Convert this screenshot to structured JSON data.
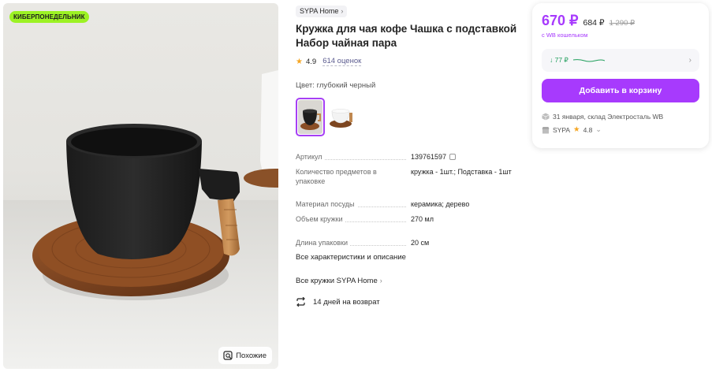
{
  "photo": {
    "badge": "КИБЕРПОНЕДЕЛЬНИК",
    "similar_button": "Похожие"
  },
  "product": {
    "brand": "SYPA Home",
    "title": "Кружка для чая кофе Чашка с подставкой Набор чайная пара",
    "rating": "4.9",
    "reviews": "614 оценок",
    "color_label": "Цвет: глубокий черный"
  },
  "specs": [
    {
      "key": "Артикул",
      "value": "139761597"
    },
    {
      "key": "Количество предметов в упаковке",
      "value": "кружка - 1шт.; Подставка - 1шт"
    },
    {
      "key": "Материал посуды",
      "value": "керамика; дерево"
    },
    {
      "key": "Объем кружки",
      "value": "270 мл"
    },
    {
      "key": "Длина упаковки",
      "value": "20 см"
    }
  ],
  "links": {
    "all_specs": "Все характеристики и описание",
    "all_brand": "Все кружки SYPA Home"
  },
  "returns": "14 дней на возврат",
  "card": {
    "price": "670 ₽",
    "price_no_wallet": "684 ₽",
    "price_old": "1 290 ₽",
    "wallet_note": "с WB кошельком",
    "cashback": "↓ 77 ₽",
    "add_to_cart": "Добавить в корзину",
    "delivery": "31 января, склад Электросталь WB",
    "seller_name": "SYPA",
    "seller_rating": "4.8"
  },
  "colors": {
    "accent": "#a73afd",
    "badge": "#9cf224",
    "cashback_green": "#1f9e5b"
  }
}
